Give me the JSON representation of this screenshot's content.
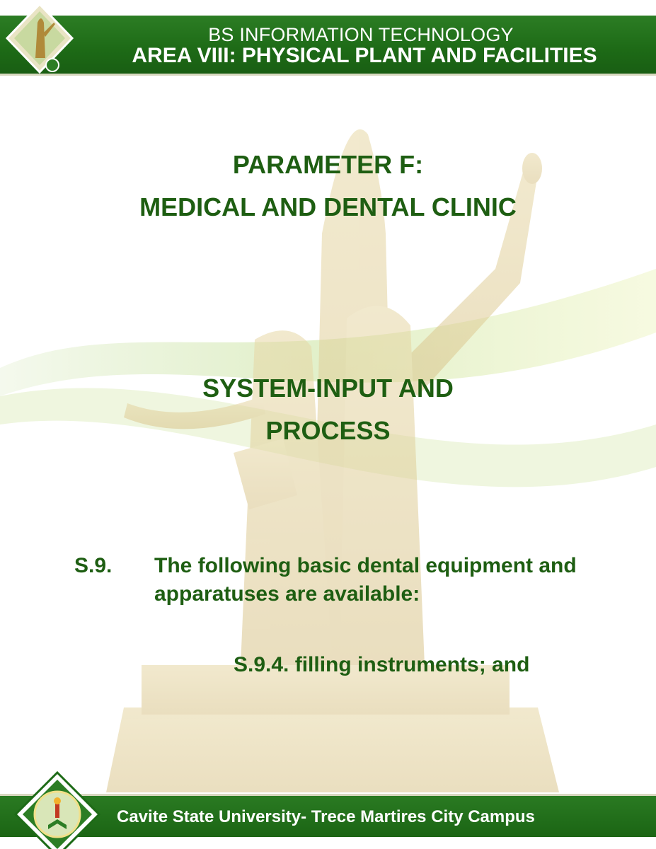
{
  "header": {
    "program": "BS INFORMATION TECHNOLOGY",
    "area": "AREA VIII: PHYSICAL PLANT AND FACILITIES"
  },
  "headings": {
    "parameter": "PARAMETER F:",
    "parameter_name": "MEDICAL AND DENTAL CLINIC",
    "section_line1": "SYSTEM-INPUT AND",
    "section_line2": "PROCESS"
  },
  "standard": {
    "number": "S.9.",
    "text": "The following basic dental equipment and apparatuses are available:",
    "sub_item": "S.9.4. filling instruments; and"
  },
  "footer": {
    "campus": "Cavite State University- Trece Martires City Campus"
  },
  "colors": {
    "brand_green": "#1d6a16",
    "heading_green": "#1e5e12"
  }
}
